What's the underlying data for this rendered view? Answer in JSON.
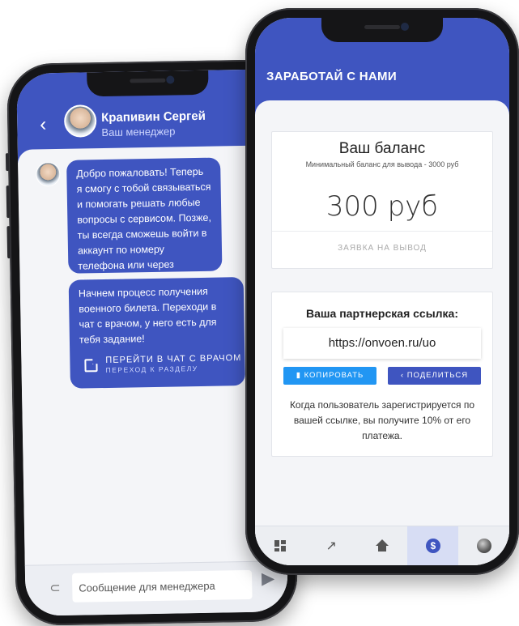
{
  "chat_phone": {
    "header": {
      "back_label": "‹",
      "manager_name": "Крапивин Сергей",
      "manager_role": "Ваш менеджер"
    },
    "messages": [
      {
        "text": "Добро пожаловать! Теперь я смогу с тобой связываться и помогать решать любые вопросы с сервисом. Позже, ты всегда сможешь войти в аккаунт по номеру телефона или через Вконтакте."
      },
      {
        "text": "Начнем процесс получения военного билета. Переходи в чат с врачом, у него есть для тебя задание!",
        "link_title": "ПЕРЕЙТИ В ЧАТ С ВРАЧОМ",
        "link_subtitle": "ПЕРЕХОД К РАЗДЕЛУ"
      }
    ],
    "composer": {
      "placeholder": "Сообщение для менеджера"
    }
  },
  "earn_phone": {
    "title": "ЗАРАБОТАЙ С НАМИ",
    "balance": {
      "title": "Ваш баланс",
      "subtitle": "Минимальный баланс для вывода - 3000 руб",
      "amount": "300 руб",
      "withdraw_label": "ЗАЯВКА НА ВЫВОД"
    },
    "partner": {
      "title": "Ваша партнерская ссылка:",
      "link": "https://onvoen.ru/uo",
      "copy_label": "КОПИРОВАТЬ",
      "share_label": "ПОДЕЛИТЬСЯ",
      "description": "Когда пользователь зарегистрируется по вашей ссылке, вы получите 10% от его платежа."
    },
    "tabs": [
      {
        "icon": "dashboard-icon"
      },
      {
        "icon": "trending-icon"
      },
      {
        "icon": "home-icon"
      },
      {
        "icon": "dollar-icon",
        "active": true
      },
      {
        "icon": "profile-avatar"
      }
    ]
  },
  "colors": {
    "brand": "#3f55c0",
    "accent": "#2196f3"
  }
}
